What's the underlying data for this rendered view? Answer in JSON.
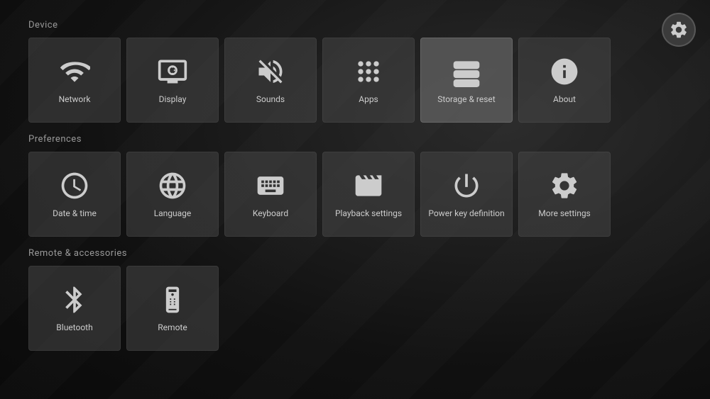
{
  "gear": {
    "label": "Settings"
  },
  "sections": {
    "device": {
      "label": "Device",
      "tiles": [
        {
          "id": "network",
          "label": "Network",
          "icon": "wifi"
        },
        {
          "id": "display",
          "label": "Display",
          "icon": "display"
        },
        {
          "id": "sounds",
          "label": "Sounds",
          "icon": "sound-off"
        },
        {
          "id": "apps",
          "label": "Apps",
          "icon": "apps"
        },
        {
          "id": "storage",
          "label": "Storage & reset",
          "icon": "storage",
          "active": true
        },
        {
          "id": "about",
          "label": "About",
          "icon": "info"
        }
      ]
    },
    "preferences": {
      "label": "Preferences",
      "tiles": [
        {
          "id": "datetime",
          "label": "Date & time",
          "icon": "clock"
        },
        {
          "id": "language",
          "label": "Language",
          "icon": "globe"
        },
        {
          "id": "keyboard",
          "label": "Keyboard",
          "icon": "keyboard"
        },
        {
          "id": "playback",
          "label": "Playback settings",
          "icon": "film"
        },
        {
          "id": "power",
          "label": "Power key definition",
          "icon": "power"
        },
        {
          "id": "more",
          "label": "More settings",
          "icon": "gear"
        }
      ]
    },
    "remote": {
      "label": "Remote & accessories",
      "tiles": [
        {
          "id": "bluetooth",
          "label": "Bluetooth",
          "icon": "bluetooth"
        },
        {
          "id": "remote",
          "label": "Remote",
          "icon": "remote"
        }
      ]
    }
  }
}
